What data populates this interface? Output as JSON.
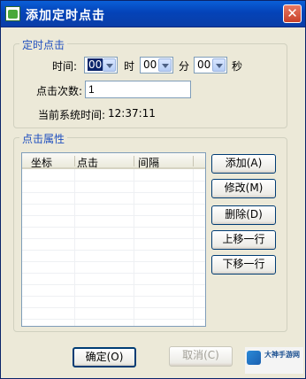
{
  "window": {
    "title": "添加定时点击",
    "close_glyph": "✕"
  },
  "timer_group": {
    "legend": "定时点击",
    "time_label": "时间:",
    "hour_value": "00",
    "hour_unit": "时",
    "minute_value": "00",
    "minute_unit": "分",
    "second_value": "00",
    "second_unit": "秒",
    "click_count_label": "点击次数:",
    "click_count_value": "1",
    "system_time_label": "当前系统时间:",
    "system_time_value": "12:37:11"
  },
  "attr_group": {
    "legend": "点击属性",
    "columns": [
      "坐标",
      "点击",
      "间隔"
    ],
    "buttons": {
      "add": "添加(A)",
      "edit": "修改(M)",
      "delete": "删除(D)",
      "move_up": "上移一行",
      "move_down": "下移一行"
    }
  },
  "footer": {
    "ok": "确定(O)",
    "cancel": "取消(C)"
  },
  "watermark": {
    "text": "大神手游网"
  },
  "icons": {
    "app": "app-icon",
    "close": "close-icon",
    "dropdown": "chevron-down-icon"
  }
}
